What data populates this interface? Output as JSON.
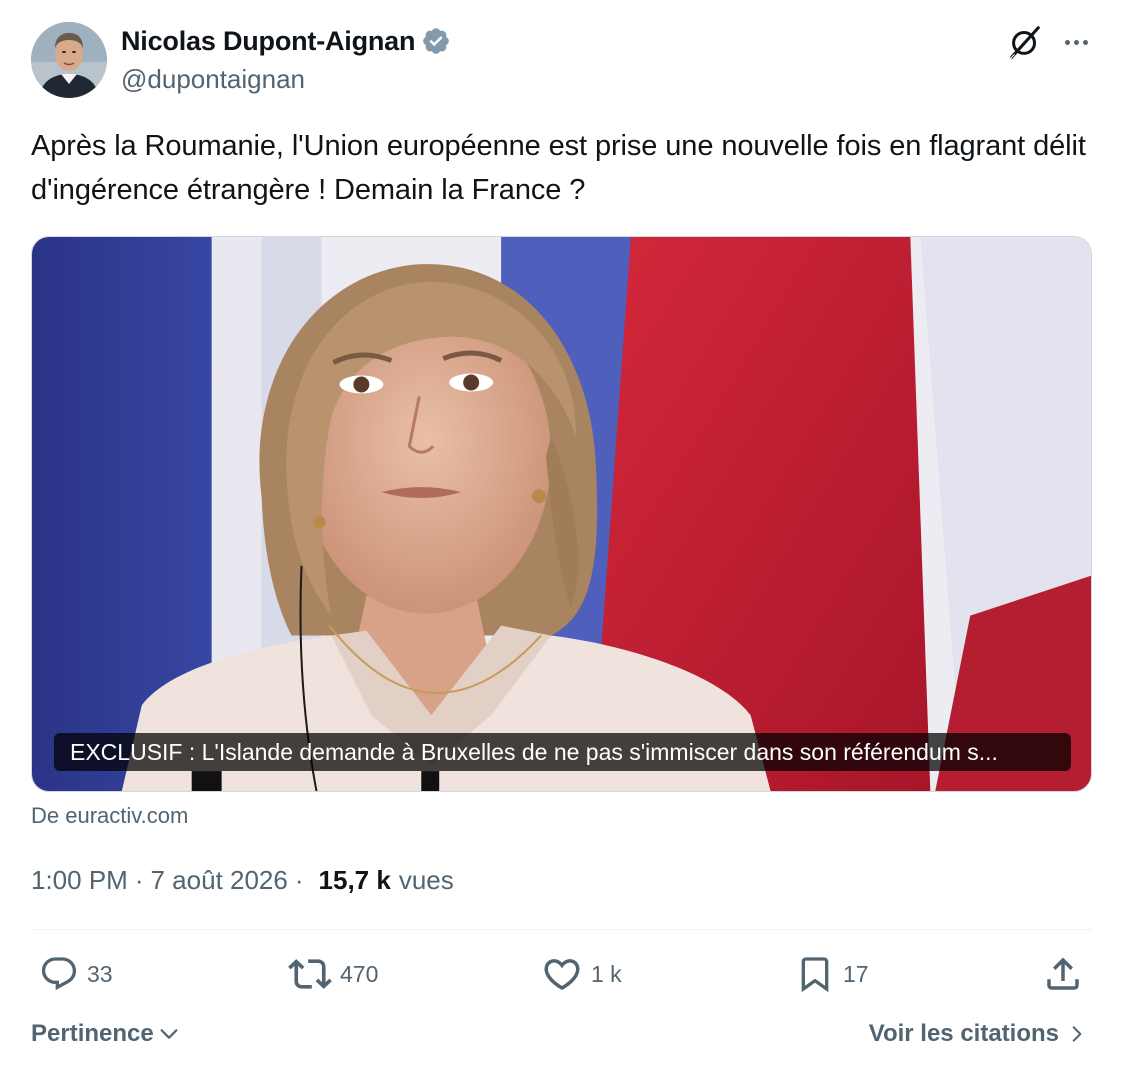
{
  "author": {
    "display_name": "Nicolas Dupont-Aignan",
    "handle": "@dupontaignan",
    "verified": true,
    "verified_color": "#829aab"
  },
  "tweet": {
    "text": "Après la Roumanie, l'Union européenne est prise une nouvelle fois en flagrant délit d'ingérence étrangère ! Demain la France ?"
  },
  "media": {
    "caption": "EXCLUSIF : L'Islande demande à Bruxelles de ne pas s'immiscer dans son référendum s...",
    "source": "De euractiv.com"
  },
  "meta": {
    "time": "1:00 PM",
    "separator": "·",
    "date": "7 août 2026",
    "views_count": "15,7 k",
    "views_label": "vues"
  },
  "actions": {
    "replies": "33",
    "reposts": "470",
    "likes": "1 k",
    "bookmarks": "17"
  },
  "footer": {
    "sort_label": "Pertinence",
    "quotes_label": "Voir les citations"
  },
  "colors": {
    "text_primary": "#0f1419",
    "text_secondary": "#536471",
    "border": "#cfd9de",
    "divider": "#eff3f4"
  }
}
